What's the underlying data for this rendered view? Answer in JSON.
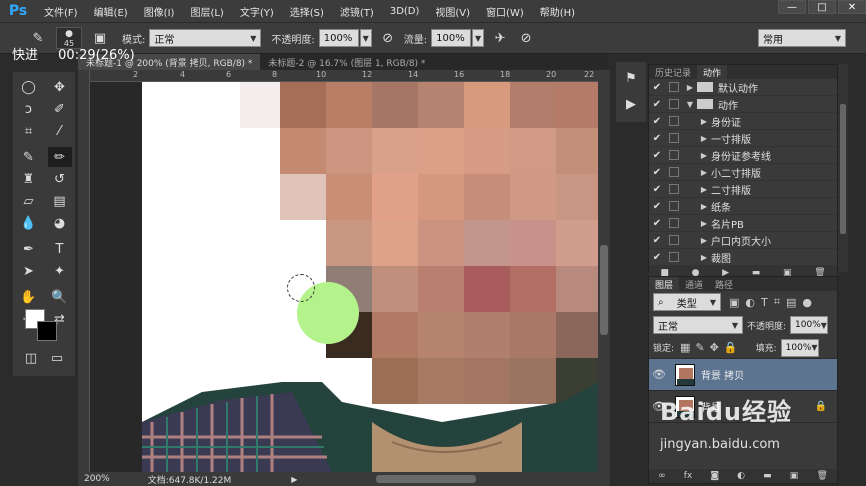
{
  "menubar": {
    "logo": "Ps",
    "items": [
      "文件(F)",
      "编辑(E)",
      "图像(I)",
      "图层(L)",
      "文字(Y)",
      "选择(S)",
      "滤镜(T)",
      "3D(D)",
      "视图(V)",
      "窗口(W)",
      "帮助(H)"
    ],
    "window_buttons": [
      "—",
      "□",
      "✕"
    ]
  },
  "options": {
    "brush_size": "45",
    "mode_label": "模式:",
    "mode_value": "正常",
    "opacity_label": "不透明度:",
    "opacity_value": "100%",
    "flow_label": "流量:",
    "flow_value": "100%",
    "workspace": "常用"
  },
  "overlay": {
    "speed": "快进",
    "time": "00:29(26%)"
  },
  "document_tabs": [
    {
      "label": "未标题-1 @ 200% (背景 拷贝, RGB/8) *",
      "active": true
    },
    {
      "label": "未标题-2 @ 16.7% (图层 1, RGB/8) *",
      "active": false
    }
  ],
  "ruler_numbers": [
    "",
    "2",
    "4",
    "6",
    "8",
    "10",
    "12",
    "14",
    "16",
    "18",
    "20",
    "22"
  ],
  "status": {
    "zoom": "200%",
    "doc": "文档:647.8K/1.22M"
  },
  "history_panel": {
    "tabs": [
      "历史记录",
      "动作"
    ],
    "active_tab": 1,
    "rows": [
      {
        "label": "默认动作",
        "kind": "folder",
        "depth": 0
      },
      {
        "label": "动作",
        "kind": "folder",
        "depth": 0
      },
      {
        "label": "身份证",
        "kind": "action",
        "depth": 1
      },
      {
        "label": "一寸排版",
        "kind": "action",
        "depth": 1
      },
      {
        "label": "身份证参考线",
        "kind": "action",
        "depth": 1
      },
      {
        "label": "小二寸排版",
        "kind": "action",
        "depth": 1
      },
      {
        "label": "二寸排版",
        "kind": "action",
        "depth": 1
      },
      {
        "label": "纸条",
        "kind": "action",
        "depth": 1
      },
      {
        "label": "名片PB",
        "kind": "action",
        "depth": 1
      },
      {
        "label": "户口内页大小",
        "kind": "action",
        "depth": 1
      },
      {
        "label": "裁图",
        "kind": "action",
        "depth": 1
      }
    ],
    "footer_icons": [
      "stop-icon",
      "record-icon",
      "play-icon",
      "folder-icon",
      "new-icon",
      "delete-icon"
    ]
  },
  "layers_panel": {
    "tabs": [
      "图层",
      "通道",
      "路径"
    ],
    "active_tab": 0,
    "filter_label": "类型",
    "blend_mode": "正常",
    "opacity_label": "不透明度:",
    "opacity_value": "100%",
    "lock_label": "锁定:",
    "fill_label": "填充:",
    "fill_value": "100%",
    "layers": [
      {
        "name": "背景 拷贝",
        "selected": true,
        "locked": false
      },
      {
        "name": "背景",
        "selected": false,
        "locked": true
      }
    ]
  },
  "watermark": {
    "logo": "Baidu经验",
    "url": "jingyan.baidu.com"
  }
}
